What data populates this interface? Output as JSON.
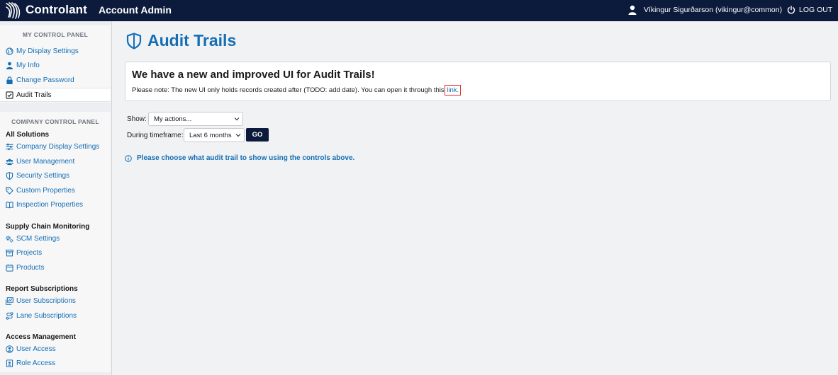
{
  "topbar": {
    "brand": "Controlant",
    "app_title": "Account Admin",
    "user_name": "Víkingur Sigurðarson (vikingur@common)",
    "logout_label": "LOG OUT",
    "icons": {
      "logo": "controlant-logo",
      "user": "user-icon",
      "logout": "power-icon"
    }
  },
  "sidebar": {
    "my_panel": {
      "title": "MY CONTROL PANEL",
      "items": [
        {
          "label": "My Display Settings",
          "icon": "globe-icon"
        },
        {
          "label": "My Info",
          "icon": "user-icon"
        },
        {
          "label": "Change Password",
          "icon": "lock-icon"
        },
        {
          "label": "Audit Trails",
          "icon": "checkbox-icon",
          "active": true
        }
      ]
    },
    "company_panel": {
      "title": "COMPANY CONTROL PANEL",
      "sections": [
        {
          "title": "All Solutions",
          "items": [
            {
              "label": "Company Display Settings",
              "icon": "sliders-icon"
            },
            {
              "label": "User Management",
              "icon": "users-icon"
            },
            {
              "label": "Security Settings",
              "icon": "shield-icon"
            },
            {
              "label": "Custom Properties",
              "icon": "tag-icon"
            },
            {
              "label": "Inspection Properties",
              "icon": "book-icon"
            }
          ]
        },
        {
          "title": "Supply Chain Monitoring",
          "items": [
            {
              "label": "SCM Settings",
              "icon": "gears-icon"
            },
            {
              "label": "Projects",
              "icon": "archive-icon"
            },
            {
              "label": "Products",
              "icon": "calendar-icon"
            }
          ]
        },
        {
          "title": "Report Subscriptions",
          "items": [
            {
              "label": "User Subscriptions",
              "icon": "chart-subscribe-icon"
            },
            {
              "label": "Lane Subscriptions",
              "icon": "route-icon"
            }
          ]
        },
        {
          "title": "Access Management",
          "items": [
            {
              "label": "User Access",
              "icon": "user-circle-icon"
            },
            {
              "label": "Role Access",
              "icon": "id-badge-icon"
            }
          ]
        }
      ]
    }
  },
  "main": {
    "title": "Audit Trails",
    "title_icon": "shield-icon",
    "notice": {
      "heading": "We have a new and improved UI for Audit Trails!",
      "text_before": "Please note: The new UI only holds records created after (TODO: add date). You can open it through this ",
      "link_label": "link",
      "text_after": "."
    },
    "filters": {
      "show_label": "Show:",
      "show_value": "My actions...",
      "timeframe_label": "During timeframe:",
      "timeframe_value": "Last 6 months",
      "go_label": "GO"
    },
    "info_message": "Please choose what audit trail to show using the controls above."
  },
  "colors": {
    "topbar": "#0c1a3c",
    "link": "#146eb4",
    "highlight": "#e03424",
    "background": "#f1f2f4"
  }
}
